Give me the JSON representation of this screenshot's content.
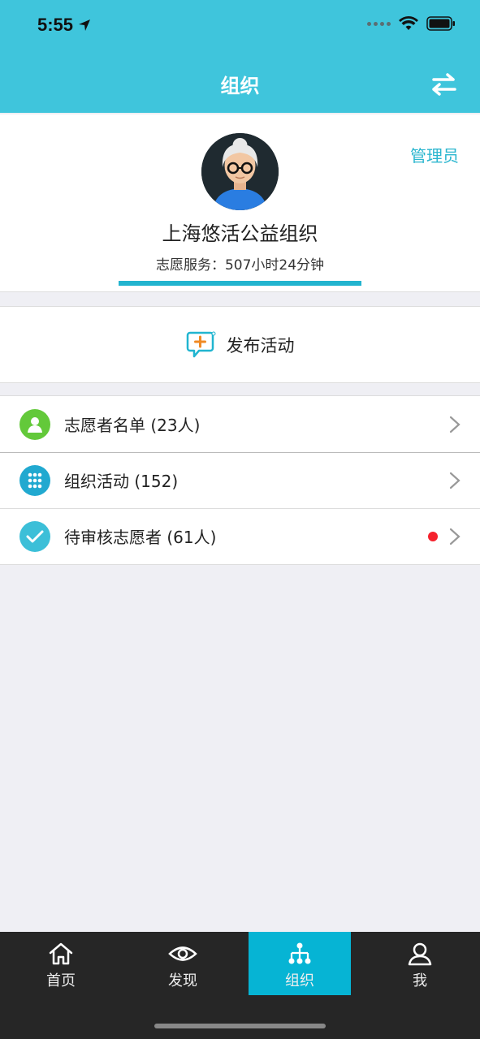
{
  "status_bar": {
    "time": "5:55"
  },
  "header": {
    "title": "组织",
    "swap_icon": "swap-arrows-icon"
  },
  "profile": {
    "role_badge": "管理员",
    "org_name": "上海悠活公益组织",
    "service_time": "志愿服务：507小时24分钟",
    "progress_percent": 100,
    "colors": {
      "progress": "#22b4cf"
    }
  },
  "publish": {
    "label": "发布活动",
    "icon": "chat-plus-icon"
  },
  "menu": [
    {
      "label": "志愿者名单 (23人)",
      "icon": "person-icon",
      "color": "#63c93a",
      "has_badge": false
    },
    {
      "label": "组织活动 (152)",
      "icon": "dots-grid-icon",
      "color": "#21a9d0",
      "has_badge": false
    },
    {
      "label": "待审核志愿者 (61人)",
      "icon": "check-icon",
      "color": "#3cbfd8",
      "has_badge": true
    }
  ],
  "tabs": [
    {
      "label": "首页",
      "icon": "home-icon",
      "active": false
    },
    {
      "label": "发现",
      "icon": "eye-icon",
      "active": false
    },
    {
      "label": "组织",
      "icon": "org-tree-icon",
      "active": true
    },
    {
      "label": "我",
      "icon": "user-icon",
      "active": false
    }
  ],
  "colors": {
    "header": "#3fc5dc",
    "accent": "#06b4d4",
    "badge": "#f5222d"
  }
}
